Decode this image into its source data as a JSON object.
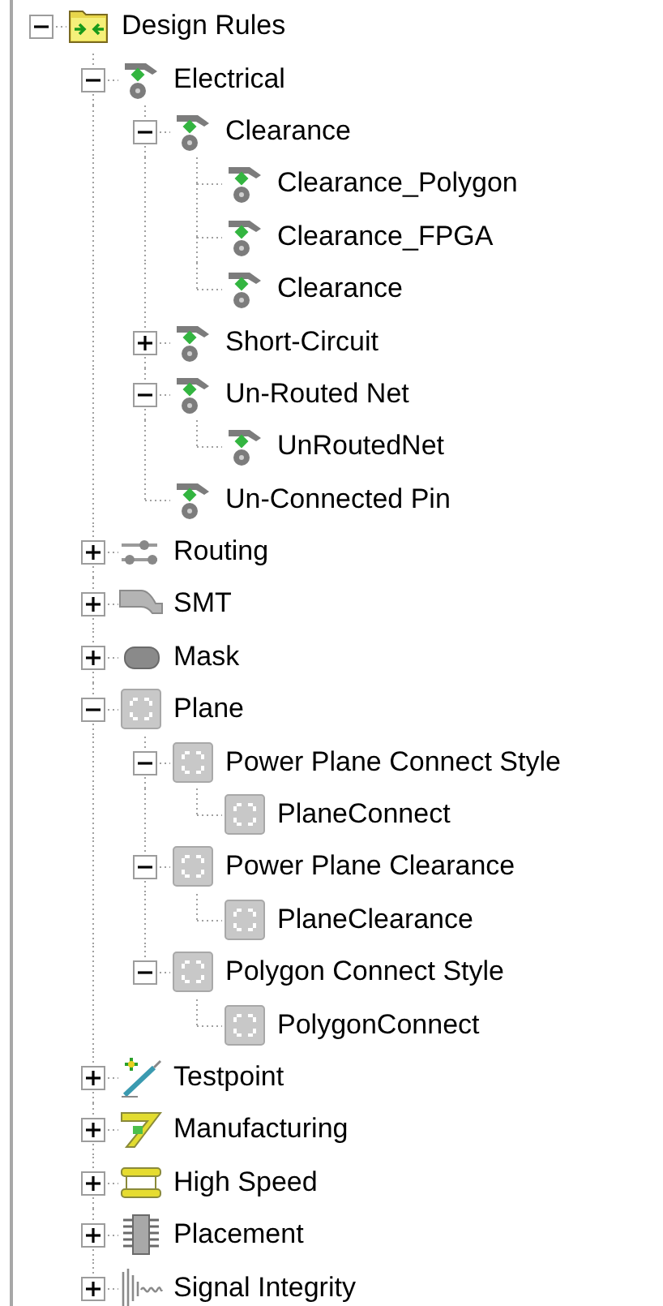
{
  "tree": [
    {
      "label": "Design Rules",
      "kind": "folder",
      "expanded": true,
      "children": [
        {
          "label": "Electrical",
          "kind": "rule",
          "expanded": true,
          "children": [
            {
              "label": "Clearance",
              "kind": "rule",
              "expanded": true,
              "children": [
                {
                  "label": "Clearance_Polygon",
                  "kind": "rule"
                },
                {
                  "label": "Clearance_FPGA",
                  "kind": "rule"
                },
                {
                  "label": "Clearance",
                  "kind": "rule"
                }
              ]
            },
            {
              "label": "Short-Circuit",
              "kind": "rule",
              "expanded": false
            },
            {
              "label": "Un-Routed Net",
              "kind": "rule",
              "expanded": true,
              "children": [
                {
                  "label": "UnRoutedNet",
                  "kind": "rule"
                }
              ]
            },
            {
              "label": "Un-Connected Pin",
              "kind": "rule"
            }
          ]
        },
        {
          "label": "Routing",
          "kind": "routing",
          "expanded": false
        },
        {
          "label": "SMT",
          "kind": "smt",
          "expanded": false
        },
        {
          "label": "Mask",
          "kind": "mask",
          "expanded": false
        },
        {
          "label": "Plane",
          "kind": "plane",
          "expanded": true,
          "children": [
            {
              "label": "Power Plane Connect Style",
              "kind": "plane",
              "expanded": true,
              "children": [
                {
                  "label": "PlaneConnect",
                  "kind": "plane"
                }
              ]
            },
            {
              "label": "Power Plane Clearance",
              "kind": "plane",
              "expanded": true,
              "children": [
                {
                  "label": "PlaneClearance",
                  "kind": "plane"
                }
              ]
            },
            {
              "label": "Polygon Connect Style",
              "kind": "plane",
              "expanded": true,
              "children": [
                {
                  "label": "PolygonConnect",
                  "kind": "plane"
                }
              ]
            }
          ]
        },
        {
          "label": "Testpoint",
          "kind": "testpoint",
          "expanded": false
        },
        {
          "label": "Manufacturing",
          "kind": "manufacturing",
          "expanded": false
        },
        {
          "label": "High Speed",
          "kind": "highspeed",
          "expanded": false
        },
        {
          "label": "Placement",
          "kind": "placement",
          "expanded": false
        },
        {
          "label": "Signal Integrity",
          "kind": "signal",
          "expanded": false
        }
      ]
    }
  ]
}
